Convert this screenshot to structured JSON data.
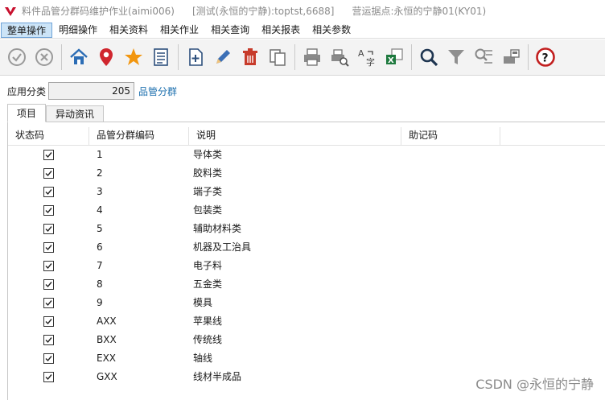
{
  "window": {
    "program_title": "料件品管分群码维护作业(aimi006)",
    "env_title": "[测试(永恒的宁静):toptst,6688]",
    "site_title": "营运据点:永恒的宁静01(KY01)"
  },
  "menu": {
    "items": [
      "整单操作",
      "明细操作",
      "相关资料",
      "相关作业",
      "相关查询",
      "相关报表",
      "相关参数"
    ]
  },
  "toolbar": {
    "icons": [
      "confirm-icon",
      "cancel-icon",
      "home-icon",
      "location-pin-icon",
      "favorite-star-icon",
      "list-icon",
      "new-document-icon",
      "edit-pencil-icon",
      "delete-trash-icon",
      "copy-icon",
      "print-icon",
      "print-preview-icon",
      "translate-icon",
      "export-excel-icon",
      "search-icon",
      "filter-icon",
      "advanced-filter-icon",
      "save-print-icon",
      "help-icon"
    ]
  },
  "form": {
    "category_label": "应用分类",
    "category_value": "205",
    "category_desc": "品管分群"
  },
  "tabs": [
    "项目",
    "异动资讯"
  ],
  "grid": {
    "columns": [
      "状态码",
      "品管分群编码",
      "说明",
      "助记码"
    ],
    "rows": [
      {
        "checked": true,
        "code": "1",
        "desc": "导体类",
        "mnemonic": ""
      },
      {
        "checked": true,
        "code": "2",
        "desc": "胶料类",
        "mnemonic": ""
      },
      {
        "checked": true,
        "code": "3",
        "desc": "端子类",
        "mnemonic": ""
      },
      {
        "checked": true,
        "code": "4",
        "desc": "包装类",
        "mnemonic": ""
      },
      {
        "checked": true,
        "code": "5",
        "desc": "辅助材料类",
        "mnemonic": ""
      },
      {
        "checked": true,
        "code": "6",
        "desc": "机器及工治具",
        "mnemonic": ""
      },
      {
        "checked": true,
        "code": "7",
        "desc": "电子料",
        "mnemonic": ""
      },
      {
        "checked": true,
        "code": "8",
        "desc": "五金类",
        "mnemonic": ""
      },
      {
        "checked": true,
        "code": "9",
        "desc": "模具",
        "mnemonic": ""
      },
      {
        "checked": true,
        "code": "AXX",
        "desc": "苹果线",
        "mnemonic": ""
      },
      {
        "checked": true,
        "code": "BXX",
        "desc": "传统线",
        "mnemonic": ""
      },
      {
        "checked": true,
        "code": "EXX",
        "desc": "轴线",
        "mnemonic": ""
      },
      {
        "checked": true,
        "code": "GXX",
        "desc": "线材半成品",
        "mnemonic": ""
      }
    ]
  },
  "watermark": "CSDN @永恒的宁静",
  "colors": {
    "accent": "#1c6fae",
    "logo": "#c8102e",
    "menu_active_bg": "#cce4f7"
  }
}
